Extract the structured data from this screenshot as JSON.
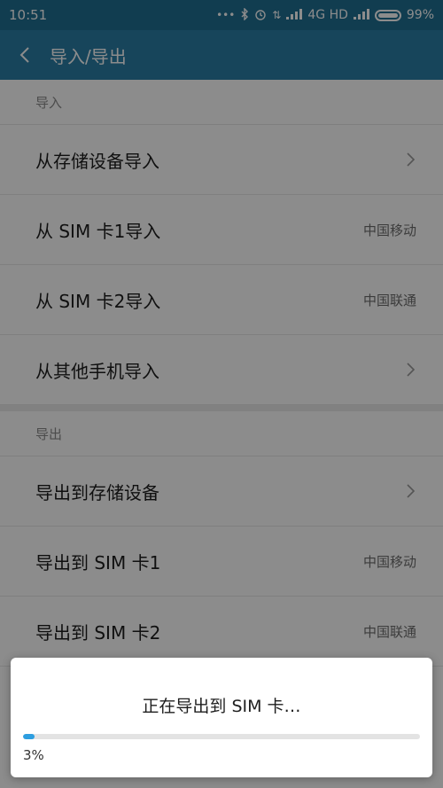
{
  "status_bar": {
    "time": "10:51",
    "icons": [
      "more-dots-icon",
      "bluetooth-icon",
      "alarm-icon",
      "data-arrows-icon",
      "signal-icon",
      "signal-icon-2"
    ],
    "network": "4G HD",
    "battery": "99%"
  },
  "header": {
    "title": "导入/导出"
  },
  "import": {
    "header": "导入",
    "items": [
      {
        "label": "从存储设备导入",
        "value": "",
        "chevron": true
      },
      {
        "label": "从 SIM 卡1导入",
        "value": "中国移动",
        "chevron": false
      },
      {
        "label": "从 SIM 卡2导入",
        "value": "中国联通",
        "chevron": false
      },
      {
        "label": "从其他手机导入",
        "value": "",
        "chevron": true
      }
    ]
  },
  "export": {
    "header": "导出",
    "items": [
      {
        "label": "导出到存储设备",
        "value": "",
        "chevron": true
      },
      {
        "label": "导出到 SIM 卡1",
        "value": "中国移动",
        "chevron": false
      },
      {
        "label": "导出到 SIM 卡2",
        "value": "中国联通",
        "chevron": false
      }
    ]
  },
  "dialog": {
    "message": "正在导出到  SIM  卡…",
    "progress_value": 0.03,
    "progress_text": "3%"
  },
  "colors": {
    "status_bar": "#1f6f93",
    "title_bar": "#2a7ea6",
    "progress": "#2d9ee0"
  }
}
